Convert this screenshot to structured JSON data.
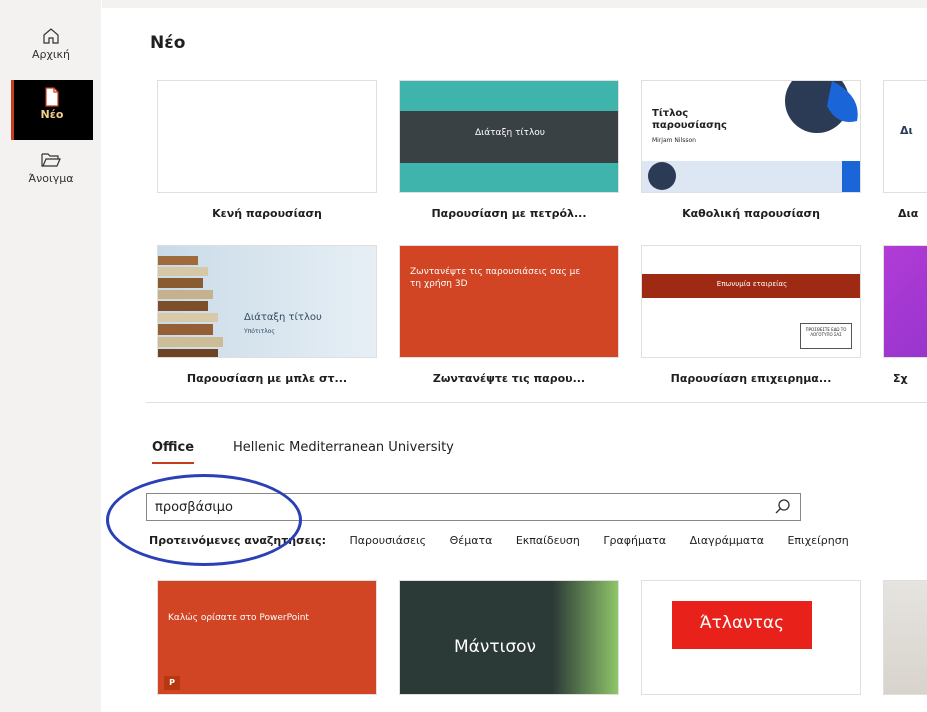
{
  "sidebar": {
    "items": [
      {
        "label": "Αρχική",
        "icon": "home-icon"
      },
      {
        "label": "Νέο",
        "icon": "new-document-icon"
      },
      {
        "label": "Άνοιγμα",
        "icon": "folder-open-icon"
      }
    ]
  },
  "main": {
    "title": "Νέο",
    "templates_row1": [
      {
        "label": "Κενή παρουσίαση",
        "thumb_text": ""
      },
      {
        "label": "Παρουσίαση με πετρόλ...",
        "thumb_text": "Διάταξη τίτλου"
      },
      {
        "label": "Καθολική παρουσίαση",
        "thumb_title": "Τίτλος παρουσίασης",
        "thumb_author": "Mirjam Nilsson"
      },
      {
        "label": "Δια",
        "thumb_text": "Δι"
      }
    ],
    "templates_row2": [
      {
        "label": "Παρουσίαση με μπλε στ...",
        "thumb_title": "Διάταξη τίτλου",
        "thumb_sub": "Υπότιτλος"
      },
      {
        "label": "Ζωντανέψτε τις παρου...",
        "thumb_title": "Ζωντανέψτε τις παρουσιάσεις σας με τη χρήση 3D"
      },
      {
        "label": "Παρουσίαση επιχειρημα...",
        "thumb_title": "Επωνυμία εταιρείας",
        "thumb_logo": "ΠΡΟΣΘΕΣΤΕ ΕΔΩ ΤΟ ΛΟΓΟΤΥΠΟ ΣΑΣ"
      },
      {
        "label": "Σχ"
      }
    ],
    "tabs": [
      {
        "label": "Office",
        "active": true
      },
      {
        "label": "Hellenic Mediterranean University",
        "active": false
      }
    ],
    "search": {
      "value": "προσβάσιμο"
    },
    "suggestions": {
      "label": "Προτεινόμενες αναζητήσεις:",
      "items": [
        "Παρουσιάσεις",
        "Θέματα",
        "Εκπαίδευση",
        "Γραφήματα",
        "Διαγράμματα",
        "Επιχείρηση"
      ]
    },
    "results": [
      {
        "title": "Καλώς ορίσατε στο PowerPoint",
        "badge": "P"
      },
      {
        "title": "Μάντισον"
      },
      {
        "title": "Άτλαντας"
      },
      {
        "title": ""
      }
    ]
  },
  "colors": {
    "accent": "#c43e1c",
    "teal": "#3fb4ad",
    "dark_slate": "#3a4145",
    "navy": "#2b3a55",
    "blue": "#1a66d9",
    "annotation": "#2b40b6"
  }
}
